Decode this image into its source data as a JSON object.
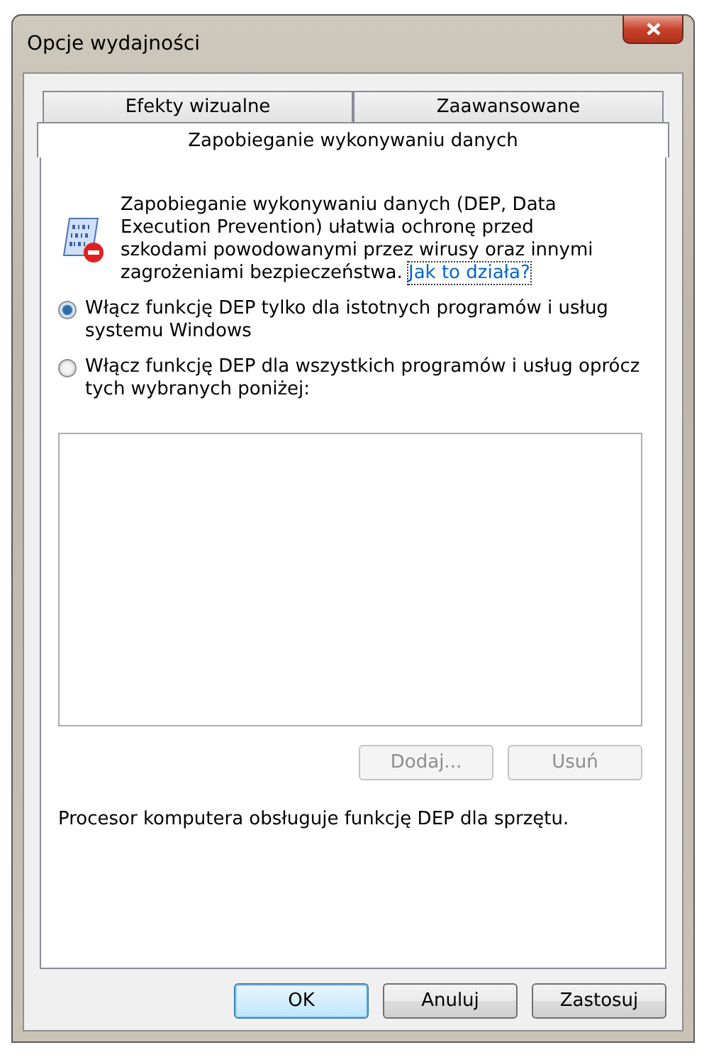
{
  "window": {
    "title": "Opcje wydajności"
  },
  "tabs": [
    {
      "label": "Efekty wizualne",
      "selected": false
    },
    {
      "label": "Zaawansowane",
      "selected": false
    },
    {
      "label": "Zapobieganie wykonywaniu danych",
      "selected": true
    }
  ],
  "info": {
    "text": "Zapobieganie wykonywaniu danych (DEP, Data Execution Prevention) ułatwia ochronę przed szkodami powodowanymi przez wirusy oraz innymi zagrożeniami bezpieczeństwa.",
    "link": "Jak to działa?"
  },
  "options": [
    {
      "label": "Włącz funkcję DEP tylko dla istotnych programów i usług systemu Windows",
      "selected": true
    },
    {
      "label": "Włącz funkcję DEP dla wszystkich programów i usług oprócz tych wybranych poniżej:",
      "selected": false
    }
  ],
  "list_buttons": [
    {
      "label": "Dodaj...",
      "disabled": true
    },
    {
      "label": "Usuń",
      "disabled": true
    }
  ],
  "status": "Procesor komputera obsługuje funkcję DEP dla sprzętu.",
  "buttons": [
    {
      "label": "OK",
      "default": true
    },
    {
      "label": "Anuluj",
      "default": false
    },
    {
      "label": "Zastosuj",
      "default": false
    }
  ]
}
